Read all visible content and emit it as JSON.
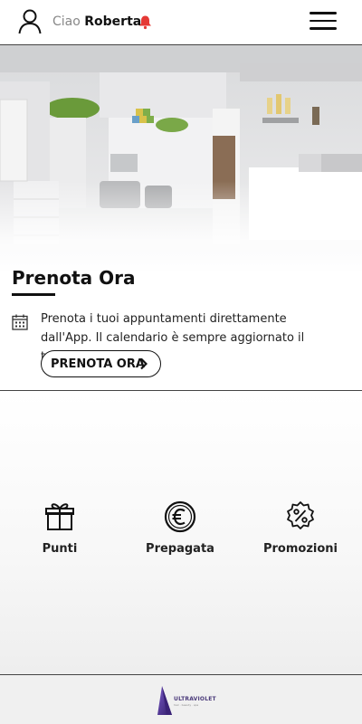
{
  "header": {
    "greeting": "Ciao",
    "user_name": "Roberta",
    "notification_color": "#e53935"
  },
  "hero": {
    "image": "salon-interior",
    "title": "Prenota Ora",
    "description": "Prenota i tuoi appuntamenti direttamente dall'App. Il calendario è sempre aggiornato il tempo reale.",
    "button_label": "PRENOTA ORA"
  },
  "features": [
    {
      "label": "Punti",
      "icon": "gift-icon"
    },
    {
      "label": "Prepagata",
      "icon": "euro-coin-icon"
    },
    {
      "label": "Promozioni",
      "icon": "discount-badge-icon"
    }
  ],
  "footer": {
    "logo_text": "ULTRAVIOLET",
    "logo_subtext": "hair · beauty · spa",
    "logo_color": "#4a2d8f"
  }
}
